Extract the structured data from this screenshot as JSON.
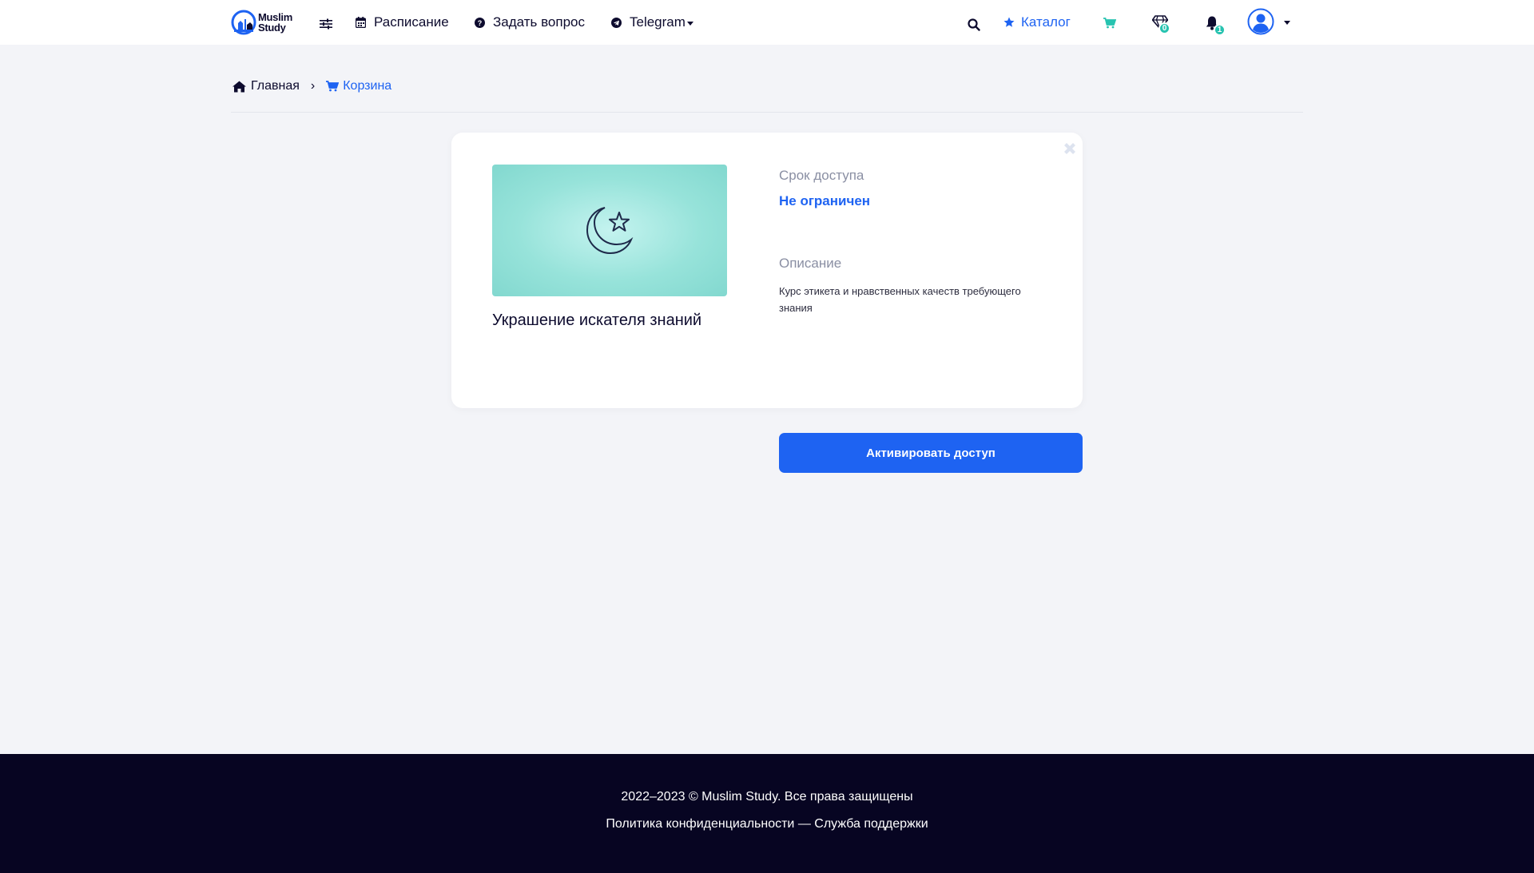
{
  "header": {
    "logo_line1": "Muslim",
    "logo_line2": "Study",
    "nav": {
      "schedule": "Расписание",
      "ask": "Задать вопрос",
      "telegram": "Telegram",
      "catalog": "Каталог"
    },
    "gem_badge": "0",
    "bell_badge": "1"
  },
  "breadcrumb": {
    "home": "Главная",
    "separator": "›",
    "current": "Корзина"
  },
  "cart_item": {
    "title": "Украшение искателя знаний",
    "access_label": "Срок доступа",
    "access_value": "Не ограничен",
    "description_label": "Описание",
    "description_value": "Курс этикета и нравственных качеств требующего знания"
  },
  "actions": {
    "activate_label": "Активировать доступ"
  },
  "footer": {
    "copyright": "2022–2023 © Muslim Study. Все права защищены",
    "links": "Политика конфиденциальности — Служба поддержки"
  },
  "colors": {
    "accent": "#1e63f2",
    "badge": "#27c3b0",
    "footer_bg": "#070522",
    "page_bg": "#f3f4f8"
  },
  "icons": {
    "logo": "muslim-study-logo",
    "settings": "sliders-icon",
    "schedule": "calendar-icon",
    "ask": "question-circle-icon",
    "telegram": "telegram-icon",
    "search": "search-icon",
    "catalog": "star-icon",
    "cart": "cart-icon",
    "gem": "gem-icon",
    "bell": "bell-icon",
    "avatar": "user-avatar-icon",
    "home": "home-icon",
    "close": "close-icon",
    "course": "crescent-star-icon"
  }
}
